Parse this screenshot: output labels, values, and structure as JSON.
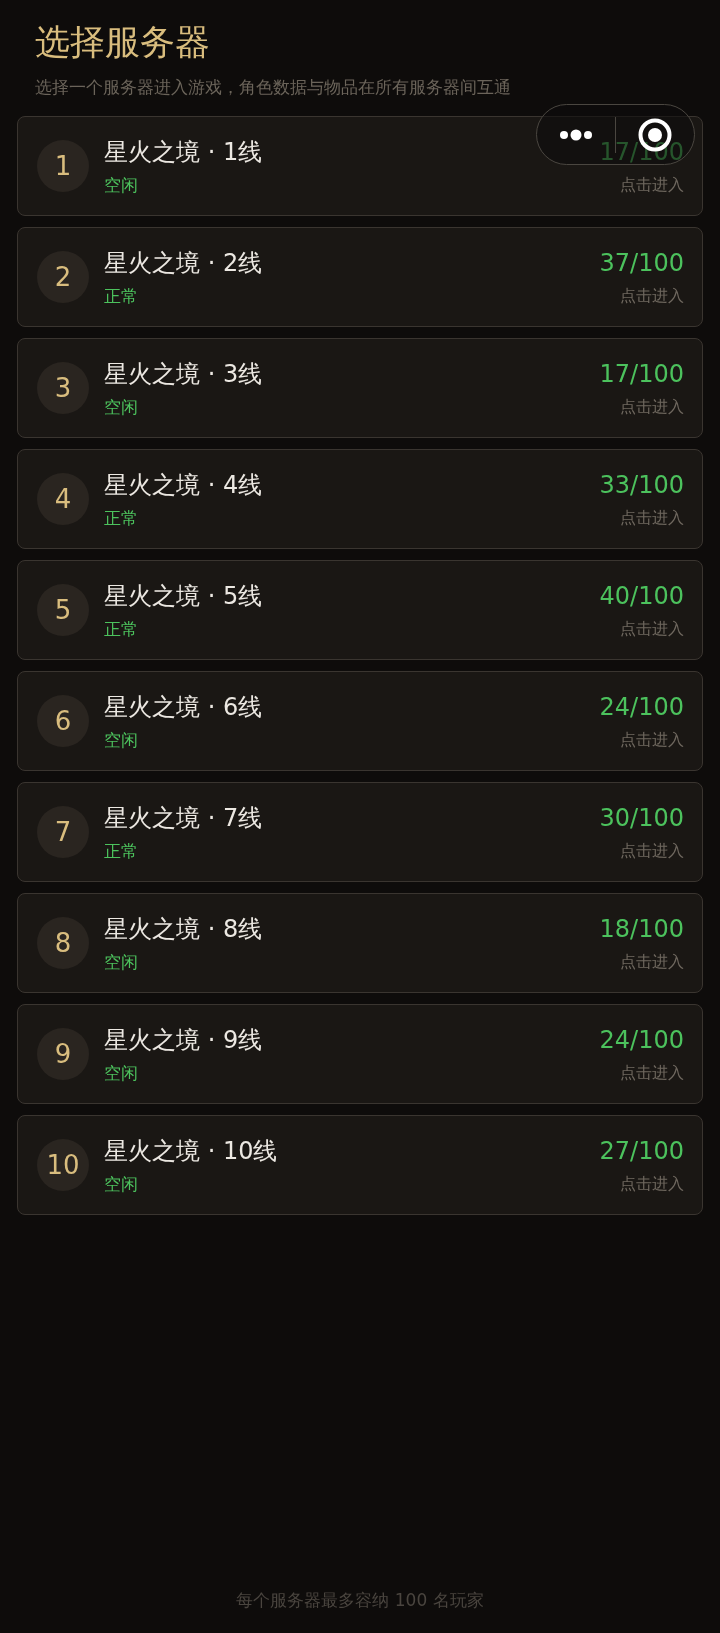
{
  "header": {
    "title": "选择服务器",
    "subtitle": "选择一个服务器进入游戏，角色数据与物品在所有服务器间互通"
  },
  "servers": [
    {
      "number": "1",
      "name": "星火之境 · 1线",
      "status": "空闲",
      "players": "17/100",
      "action": "点击进入"
    },
    {
      "number": "2",
      "name": "星火之境 · 2线",
      "status": "正常",
      "players": "37/100",
      "action": "点击进入"
    },
    {
      "number": "3",
      "name": "星火之境 · 3线",
      "status": "空闲",
      "players": "17/100",
      "action": "点击进入"
    },
    {
      "number": "4",
      "name": "星火之境 · 4线",
      "status": "正常",
      "players": "33/100",
      "action": "点击进入"
    },
    {
      "number": "5",
      "name": "星火之境 · 5线",
      "status": "正常",
      "players": "40/100",
      "action": "点击进入"
    },
    {
      "number": "6",
      "name": "星火之境 · 6线",
      "status": "空闲",
      "players": "24/100",
      "action": "点击进入"
    },
    {
      "number": "7",
      "name": "星火之境 · 7线",
      "status": "正常",
      "players": "30/100",
      "action": "点击进入"
    },
    {
      "number": "8",
      "name": "星火之境 · 8线",
      "status": "空闲",
      "players": "18/100",
      "action": "点击进入"
    },
    {
      "number": "9",
      "name": "星火之境 · 9线",
      "status": "空闲",
      "players": "24/100",
      "action": "点击进入"
    },
    {
      "number": "10",
      "name": "星火之境 · 10线",
      "status": "空闲",
      "players": "27/100",
      "action": "点击进入"
    }
  ],
  "footer": "每个服务器最多容纳 100 名玩家"
}
